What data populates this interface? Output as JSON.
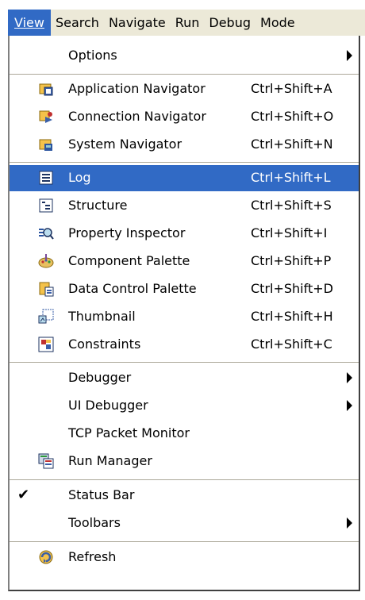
{
  "menubar": {
    "items": [
      "View",
      "Search",
      "Navigate",
      "Run",
      "Debug",
      "Mode"
    ]
  },
  "menu": {
    "options": {
      "label": "Options"
    },
    "application_navigator": {
      "label": "Application Navigator",
      "shortcut": "Ctrl+Shift+A",
      "icon": "application-navigator-icon"
    },
    "connection_navigator": {
      "label": "Connection Navigator",
      "shortcut": "Ctrl+Shift+O",
      "icon": "connection-navigator-icon"
    },
    "system_navigator": {
      "label": "System Navigator",
      "shortcut": "Ctrl+Shift+N",
      "icon": "system-navigator-icon"
    },
    "log": {
      "label": "Log",
      "shortcut": "Ctrl+Shift+L",
      "icon": "log-icon"
    },
    "structure": {
      "label": "Structure",
      "shortcut": "Ctrl+Shift+S",
      "icon": "structure-icon"
    },
    "property_inspector": {
      "label": "Property Inspector",
      "shortcut": "Ctrl+Shift+I",
      "icon": "property-inspector-icon"
    },
    "component_palette": {
      "label": "Component Palette",
      "shortcut": "Ctrl+Shift+P",
      "icon": "component-palette-icon"
    },
    "data_control_palette": {
      "label": "Data Control Palette",
      "shortcut": "Ctrl+Shift+D",
      "icon": "data-control-palette-icon"
    },
    "thumbnail": {
      "label": "Thumbnail",
      "shortcut": "Ctrl+Shift+H",
      "icon": "thumbnail-icon"
    },
    "constraints": {
      "label": "Constraints",
      "shortcut": "Ctrl+Shift+C",
      "icon": "constraints-icon"
    },
    "debugger": {
      "label": "Debugger"
    },
    "ui_debugger": {
      "label": "UI Debugger"
    },
    "tcp_packet_monitor": {
      "label": "TCP Packet Monitor"
    },
    "run_manager": {
      "label": "Run Manager",
      "icon": "run-manager-icon"
    },
    "status_bar": {
      "label": "Status Bar",
      "checked": true
    },
    "toolbars": {
      "label": "Toolbars"
    },
    "refresh": {
      "label": "Refresh",
      "icon": "refresh-icon"
    }
  },
  "colors": {
    "highlight": "#316ac5",
    "menubar_bg": "#ece9d8"
  }
}
